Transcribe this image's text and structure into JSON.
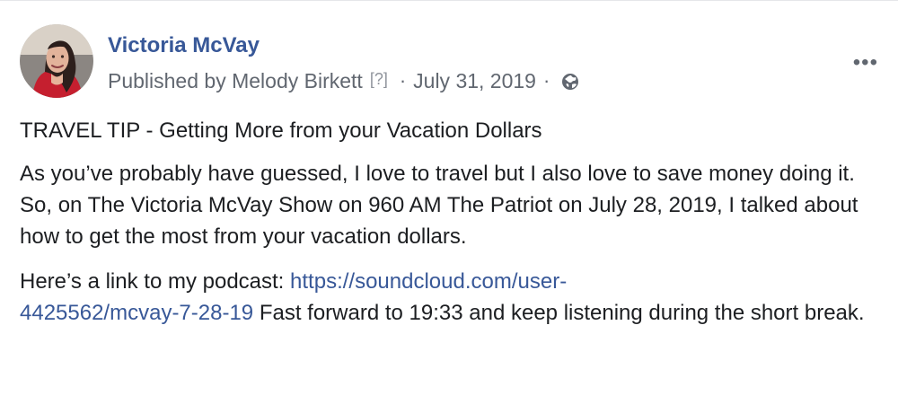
{
  "post": {
    "author": "Victoria McVay",
    "published_by": "Published by Melody Birkett",
    "help_link": "[?]",
    "date": "July 31, 2019",
    "privacy_icon": "globe-icon",
    "more_icon": "more-options-icon",
    "more_label": "•••",
    "title": "TRAVEL TIP - Getting More from your Vacation Dollars",
    "body": "As you’ve probably have guessed, I love to travel but I also love to save money doing it. So, on The Victoria McVay Show on 960 AM The Patriot on July 28, 2019, I talked about how to get the most from your vacation dollars.",
    "podcast_intro": "Here’s a link to my podcast: ",
    "podcast_link_line1": "https://soundcloud.com/user-",
    "podcast_link_line2": "4425562/mcvay-7-28-19",
    "podcast_followup": " Fast forward to 19:33 and keep listening during the short break."
  },
  "colors": {
    "link": "#385898",
    "meta": "#616770",
    "text": "#1c1e21"
  }
}
